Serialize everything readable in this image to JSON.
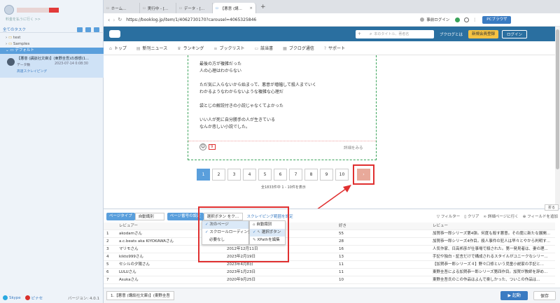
{
  "sidebar": {
    "account_name": "",
    "invite_label": "料金を払うに行く >>",
    "all_tasks_label": "全てのタスク",
    "folders": [
      {
        "label": "test"
      },
      {
        "label": "Samples"
      },
      {
        "label": "デフォルト"
      }
    ],
    "task": {
      "title": "【悪意 (講談社文庫)】(東野圭吾)の感想(1...",
      "meta": "データ数",
      "date": "2023-07-14 0:08:30",
      "mode_badge": "高速スクレイピング"
    },
    "footer": {
      "link1": "Skype",
      "link2": "ピナセ",
      "version": "バージョン: 4.0.1"
    }
  },
  "browser": {
    "tabs": [
      {
        "label": "ホーム..."
      },
      {
        "label": "実行中 - [..."
      },
      {
        "label": "データ - [..."
      },
      {
        "label": "【悪意 (講..."
      }
    ],
    "url": "https://booklog.jp/item/1/4062730170?carousel=4065325846",
    "bookmark_label": "事前ログイン",
    "browser_mode": "PCブラウザ"
  },
  "site": {
    "search_placeholder": "本のタイトル、著者名",
    "blog_btn": "ブクログとは",
    "register_btn": "新規会員登録",
    "login_btn": "ログイン",
    "nav": [
      {
        "label": "トップ",
        "icon": "home-icon"
      },
      {
        "label": "新刊ニュース",
        "icon": "book-icon"
      },
      {
        "label": "ランキング",
        "icon": "crown-icon"
      },
      {
        "label": "ブックリスト",
        "icon": "list-icon"
      },
      {
        "label": "該当書",
        "icon": "chat-icon"
      },
      {
        "label": "ブクログ通信",
        "icon": "news-icon"
      },
      {
        "label": "サポート",
        "icon": "help-icon"
      }
    ],
    "review_lines": [
      "最後の方が複雑だった",
      "人の心理はわからない",
      "",
      "ただ気に入らないから始まって、悪意が増幅して殺人までいく",
      "わかるようなわからないような複雑な心理だ",
      "",
      "袋とじの解説付きの小説じゃなくてよかった",
      "",
      "いい人が死に自分勝手の人が生きている",
      "なんか悲しい小説でした。"
    ],
    "like_count": "9",
    "read_more": "詳細をみる",
    "pages": [
      "1",
      "2",
      "3",
      "4",
      "5",
      "6",
      "7",
      "8",
      "9",
      "10",
      "›"
    ],
    "result_count": "全1833件中 1 - 10件を表示"
  },
  "panel": {
    "collapse_label": "折る",
    "page_type_label": "ページタイプ",
    "page_type_value": "自動識別",
    "page_mode_label": "ページ番号の設定",
    "page_mode_value": "選択ボタン をク...",
    "scrape_range_label": "スクレイピング範囲を設定",
    "filter_label": "フィルター",
    "clear_label": "クリア",
    "detail_label": "詳細ページに行く",
    "add_field_label": "フィールドを追加",
    "menu_left": [
      {
        "label": "次のページ",
        "checked": true
      },
      {
        "label": "スクロールローディング",
        "checked": true
      },
      {
        "label": "必要なし",
        "checked": false
      }
    ],
    "menu_right": [
      {
        "label": "自動識別",
        "selected": false
      },
      {
        "label": "選択ボタン",
        "selected": true
      },
      {
        "label": "XPathを編集",
        "selected": false
      }
    ],
    "columns": [
      "",
      "レビュアー",
      "",
      "好き",
      "レビュー"
    ],
    "rows": [
      {
        "n": "1",
        "name": "akodamさん",
        "date": "",
        "likes": "55",
        "review": "加賀恭一郎シリーズ第4弾。何度も殺す悪意。その度に新たな展開..."
      },
      {
        "n": "2",
        "name": "a.c.beats aka KIYOKAWAさん",
        "date": "",
        "likes": "28",
        "review": "加賀恭一郎シリーズ4作目。殺人事件の犯人は早々とやから判明す..."
      },
      {
        "n": "3",
        "name": "マリモさん",
        "date": "2012年12月11日",
        "likes": "16",
        "review": "人気作家、日高邦彦が仕事場で殺された。第一発見者は、妻の理..."
      },
      {
        "n": "4",
        "name": "kikto999さん",
        "date": "2023年2月19日",
        "likes": "13",
        "review": "手記や独白・証言だけで構成されるスタイルがユニークなシリー..."
      },
      {
        "n": "5",
        "name": "セシルの夕陽さん",
        "date": "2023年4月8日",
        "likes": "11",
        "review": "【加賀恭一郎シリーズ４】野々口修という児童小説家の手記と..."
      },
      {
        "n": "6",
        "name": "LULUさん",
        "date": "2023年1月23日",
        "likes": "11",
        "review": "東野圭吾による加賀恭一郎シリーズ第四作目。加賀が教師を辞め..."
      },
      {
        "n": "7",
        "name": "Asukaさん",
        "date": "2020年9月25日",
        "likes": "10",
        "review": "東野圭吾氏のこの作品はよんで楽しかった、ついこの作品は..."
      }
    ]
  },
  "footer": {
    "tab_label": "1.【悪意 (講談社文庫)】(東野圭吾",
    "run_button": "▶ 起動",
    "save_button": "保存"
  },
  "colors": {
    "accent": "#5a9fdc",
    "site_header": "#2a6fa0",
    "highlight_red": "#e03030",
    "next_page": "#e8a99a"
  }
}
